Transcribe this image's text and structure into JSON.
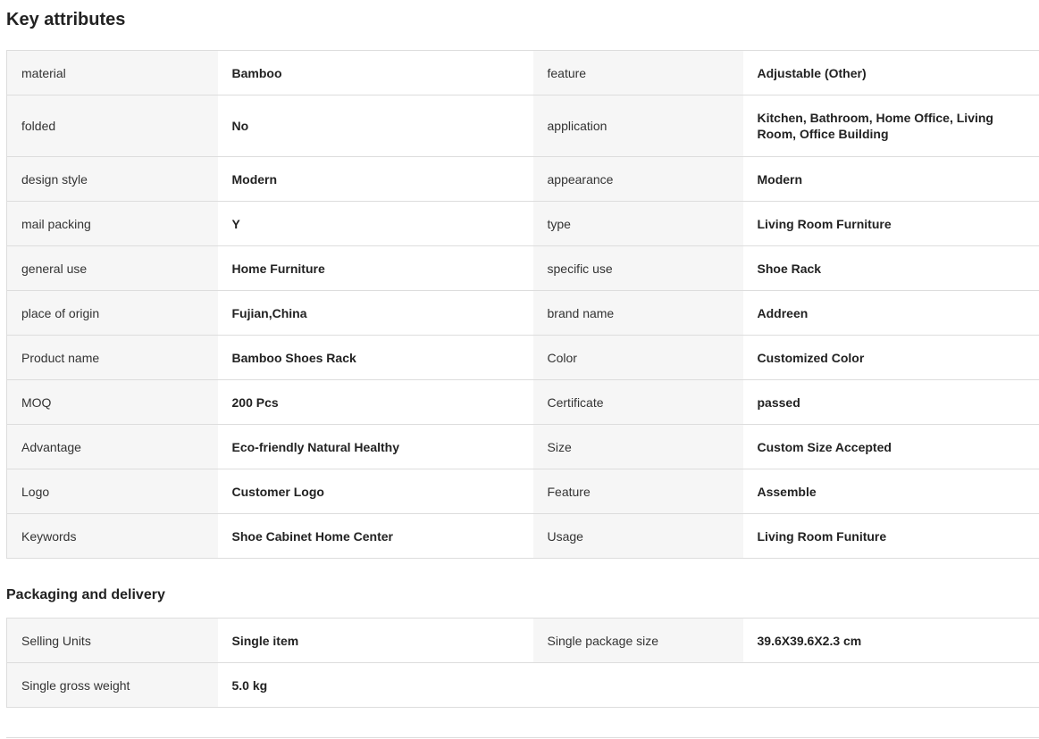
{
  "key_attributes": {
    "title": "Key attributes",
    "rows": [
      {
        "l1": "material",
        "v1": "Bamboo",
        "l2": "feature",
        "v2": "Adjustable (Other)"
      },
      {
        "l1": "folded",
        "v1": "No",
        "l2": "application",
        "v2": "Kitchen, Bathroom, Home Office, Living Room, Office Building"
      },
      {
        "l1": "design style",
        "v1": "Modern",
        "l2": "appearance",
        "v2": "Modern"
      },
      {
        "l1": "mail packing",
        "v1": "Y",
        "l2": "type",
        "v2": "Living Room Furniture"
      },
      {
        "l1": "general use",
        "v1": "Home Furniture",
        "l2": "specific use",
        "v2": "Shoe Rack"
      },
      {
        "l1": "place of origin",
        "v1": "Fujian,China",
        "l2": "brand name",
        "v2": "Addreen"
      },
      {
        "l1": "Product name",
        "v1": "Bamboo Shoes Rack",
        "l2": "Color",
        "v2": "Customized Color"
      },
      {
        "l1": "MOQ",
        "v1": "200 Pcs",
        "l2": "Certificate",
        "v2": "passed"
      },
      {
        "l1": "Advantage",
        "v1": "Eco-friendly Natural Healthy",
        "l2": "Size",
        "v2": "Custom Size Accepted"
      },
      {
        "l1": "Logo",
        "v1": "Customer Logo",
        "l2": "Feature",
        "v2": "Assemble"
      },
      {
        "l1": "Keywords",
        "v1": "Shoe Cabinet Home Center",
        "l2": "Usage",
        "v2": "Living Room Funiture"
      }
    ]
  },
  "packaging": {
    "title": "Packaging and delivery",
    "rows": [
      {
        "l1": "Selling Units",
        "v1": "Single item",
        "l2": "Single package size",
        "v2": "39.6X39.6X2.3 cm"
      },
      {
        "l1": "Single gross weight",
        "v1": "5.0 kg",
        "l2": "",
        "v2": ""
      }
    ]
  }
}
